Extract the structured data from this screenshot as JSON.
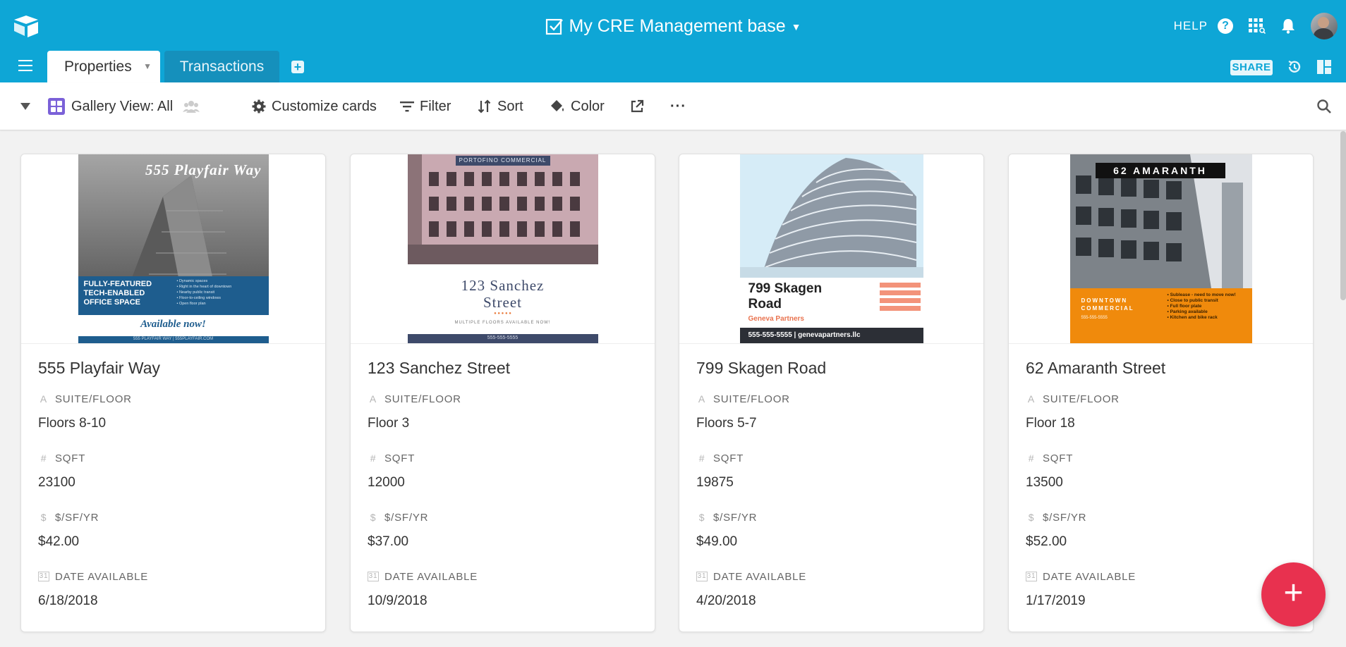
{
  "header": {
    "base_title": "My CRE Management base",
    "help_label": "HELP",
    "help_icon": "?"
  },
  "tabs": [
    {
      "label": "Properties",
      "active": true
    },
    {
      "label": "Transactions",
      "active": false
    }
  ],
  "share_label": "SHARE",
  "toolbar": {
    "view_name": "Gallery View: All",
    "customize_label": "Customize cards",
    "filter_label": "Filter",
    "sort_label": "Sort",
    "color_label": "Color",
    "more_label": "···"
  },
  "field_labels": {
    "suite": "SUITE/FLOOR",
    "sqft": "SQFT",
    "rate": "$/SF/YR",
    "date": "DATE AVAILABLE"
  },
  "field_icons": {
    "suite": "A",
    "sqft": "#",
    "rate": "$",
    "date": "31"
  },
  "cards": [
    {
      "name": "555 Playfair Way",
      "suite": "Floors 8-10",
      "sqft": "23100",
      "rate": "$42.00",
      "date": "6/18/2018",
      "poster": {
        "headline": "555 Playfair Way",
        "body": "FULLY-FEATURED TECH-ENABLED OFFICE SPACE",
        "bullets": "• Dynamic spaces\n• Right in the heart of downtown\n• Nearby public transit\n• Floor-to-ceiling windows\n• Open floor plan",
        "cta": "Available now!",
        "footer": "555 PLAYFAIR WAY   |   555PLAYFAIR.COM"
      }
    },
    {
      "name": "123 Sanchez Street",
      "suite": "Floor 3",
      "sqft": "12000",
      "rate": "$37.00",
      "date": "10/9/2018",
      "poster": {
        "headline": "PORTOFINO COMMERCIAL",
        "title_line1": "123 Sanchez",
        "title_line2": "Street",
        "dots": "● ● ● ● ●",
        "sub": "MULTIPLE FLOORS AVAILABLE NOW!",
        "footer": "555-555-5555"
      }
    },
    {
      "name": "799 Skagen Road",
      "suite": "Floors 5-7",
      "sqft": "19875",
      "rate": "$49.00",
      "date": "4/20/2018",
      "poster": {
        "title_line1": "799 Skagen",
        "title_line2": "Road",
        "brand": "Geneva Partners",
        "footer": "555-555-5555 | genevapartners.llc"
      }
    },
    {
      "name": "62 Amaranth Street",
      "suite": "Floor 18",
      "sqft": "13500",
      "rate": "$52.00",
      "date": "1/17/2019",
      "poster": {
        "headline": "62 AMARANTH",
        "brand": "DOWNTOWN COMMERCIAL",
        "phone": "555-555-5555",
        "bullets": "• Sublease - need to move now!\n• Close to public transit\n• Full floor plate\n• Parking available\n• Kitchen and bike rack"
      }
    }
  ],
  "fab_label": "+",
  "colors": {
    "topbar": "#0ea6d6",
    "tab_inactive": "#1590bc",
    "fab": "#e8314f",
    "gallery_icon": "#7b61d8"
  }
}
